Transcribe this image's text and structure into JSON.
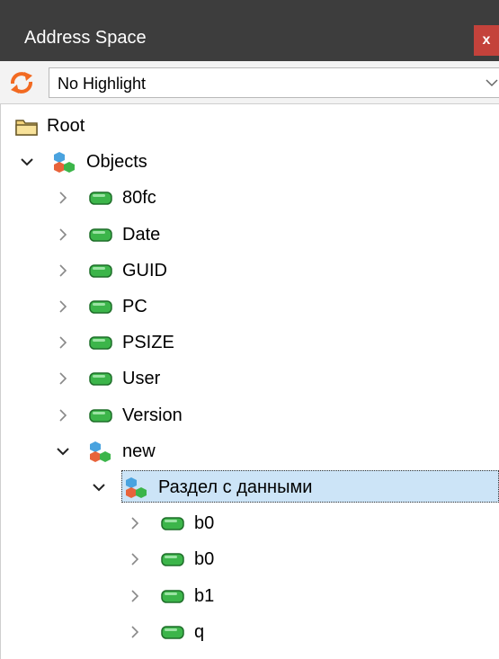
{
  "window": {
    "title": "Address Space",
    "close_label": "x"
  },
  "toolbar": {
    "highlight_value": "No Highlight"
  },
  "tree": [
    {
      "label": "Root",
      "level": 0,
      "icon": "folder-icon",
      "chevron": "none"
    },
    {
      "label": "Objects",
      "level": 0,
      "icon": "object-icon",
      "chevron": "expanded"
    },
    {
      "label": "80fc",
      "level": 1,
      "icon": "variable-icon",
      "chevron": "collapsed"
    },
    {
      "label": "Date",
      "level": 1,
      "icon": "variable-icon",
      "chevron": "collapsed"
    },
    {
      "label": "GUID",
      "level": 1,
      "icon": "variable-icon",
      "chevron": "collapsed"
    },
    {
      "label": "PC",
      "level": 1,
      "icon": "variable-icon",
      "chevron": "collapsed"
    },
    {
      "label": "PSIZE",
      "level": 1,
      "icon": "variable-icon",
      "chevron": "collapsed"
    },
    {
      "label": "User",
      "level": 1,
      "icon": "variable-icon",
      "chevron": "collapsed"
    },
    {
      "label": "Version",
      "level": 1,
      "icon": "variable-icon",
      "chevron": "collapsed"
    },
    {
      "label": "new",
      "level": 1,
      "icon": "object-icon",
      "chevron": "expanded"
    },
    {
      "label": "Раздел с данными",
      "level": 2,
      "icon": "object-icon",
      "chevron": "expanded",
      "selected": true
    },
    {
      "label": "b0",
      "level": 3,
      "icon": "variable-icon",
      "chevron": "collapsed"
    },
    {
      "label": "b0",
      "level": 3,
      "icon": "variable-icon",
      "chevron": "collapsed"
    },
    {
      "label": "b1",
      "level": 3,
      "icon": "variable-icon",
      "chevron": "collapsed"
    },
    {
      "label": "q",
      "level": 3,
      "icon": "variable-icon",
      "chevron": "collapsed"
    }
  ],
  "colors": {
    "titlebar": "#3d3d3d",
    "close": "#c4423b",
    "selection": "#cce4f7",
    "variable_green": "#3cb54a",
    "refresh_orange": "#f26a21"
  }
}
